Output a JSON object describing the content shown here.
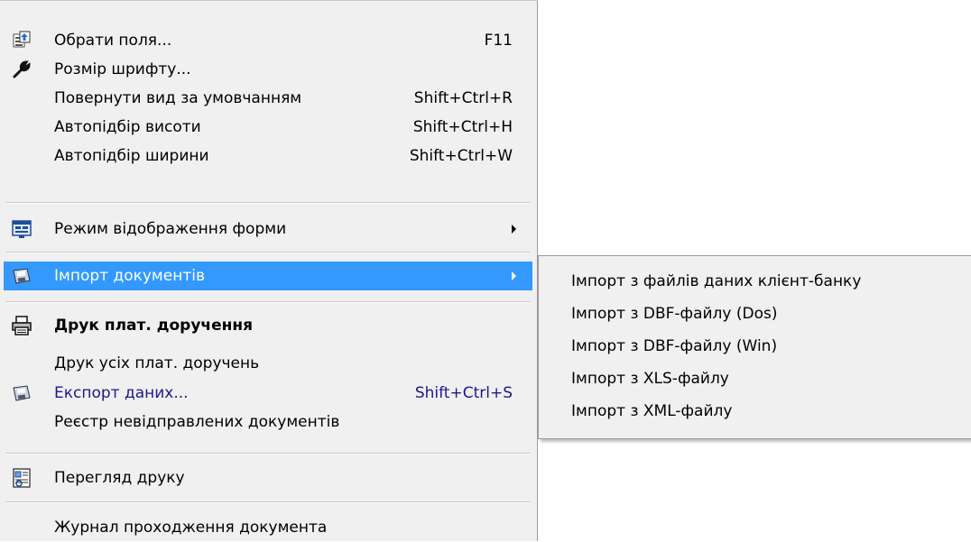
{
  "menu": {
    "items": [
      {
        "label": "Обрати поля...",
        "shortcut": "F11",
        "icon": "select-fields-icon"
      },
      {
        "label": "Розмір шрифту...",
        "shortcut": "",
        "icon": "wrench-icon"
      },
      {
        "label": "Повернути вид за умовчанням",
        "shortcut": "Shift+Ctrl+R"
      },
      {
        "label": "Автопідбір висоти",
        "shortcut": "Shift+Ctrl+H"
      },
      {
        "label": "Автопідбір ширини",
        "shortcut": "Shift+Ctrl+W"
      },
      {
        "label": "Режим відображення форми",
        "shortcut": "",
        "icon": "form-view-icon",
        "submenu": true
      },
      {
        "label": "Імпорт документів",
        "shortcut": "",
        "icon": "import-disk-icon",
        "submenu": true,
        "selected": true
      },
      {
        "label": "Друк плат. доручення",
        "shortcut": "",
        "icon": "printer-icon",
        "bold": true
      },
      {
        "label": "Друк усіх плат. доручень",
        "shortcut": ""
      },
      {
        "label": "Експорт даних...",
        "shortcut": "Shift+Ctrl+S",
        "icon": "export-disk-icon"
      },
      {
        "label": "Реєстр невідправлених документів",
        "shortcut": ""
      },
      {
        "label": "Перегляд друку",
        "shortcut": "",
        "icon": "print-preview-icon"
      },
      {
        "label": "Журнал проходження документа",
        "shortcut": ""
      }
    ]
  },
  "submenu": {
    "items": [
      {
        "label": "Імпорт з файлів даних клієнт-банку"
      },
      {
        "label": "Імпорт з DBF-файлу (Dos)"
      },
      {
        "label": "Імпорт з DBF-файлу (Win)"
      },
      {
        "label": "Імпорт з XLS-файлу"
      },
      {
        "label": "Імпорт з XML-файлу"
      }
    ]
  },
  "colors": {
    "menu_bg": "#f0f0f0",
    "selection": "#3399ff",
    "export_text": "#1a1a8c"
  }
}
